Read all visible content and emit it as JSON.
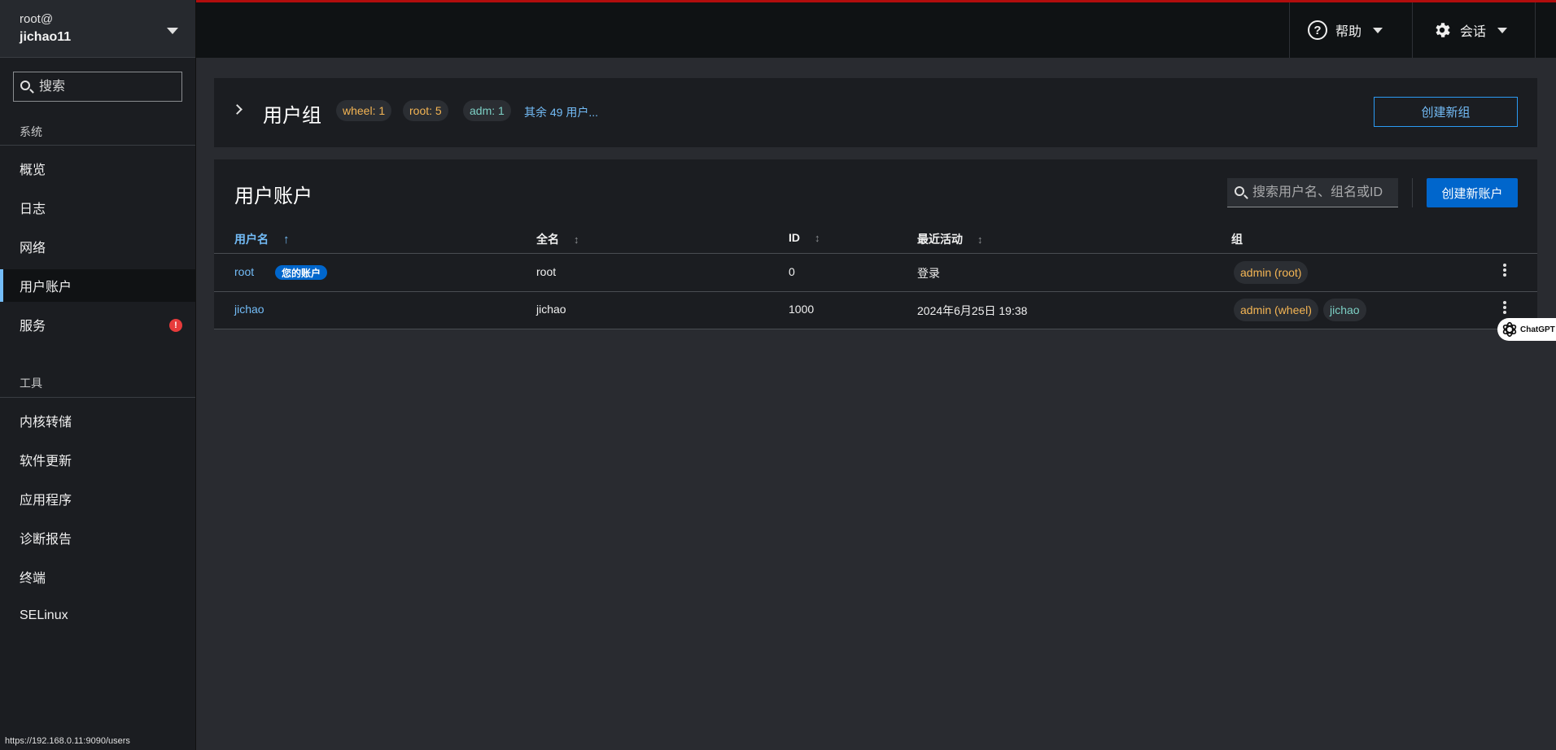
{
  "host": {
    "user": "root@",
    "name": "jichao11"
  },
  "sidebar": {
    "search_placeholder": "搜索",
    "sections": [
      {
        "label": "系统",
        "items": [
          "概览",
          "日志",
          "网络",
          "用户账户",
          "服务"
        ]
      },
      {
        "label": "工具",
        "items": [
          "内核转储",
          "软件更新",
          "应用程序",
          "诊断报告",
          "终端",
          "SELinux"
        ]
      }
    ],
    "active_item": "用户账户",
    "services_alert_glyph": "!"
  },
  "topbar": {
    "help_label": "帮助",
    "session_label": "会话"
  },
  "groups_card": {
    "title": "用户组",
    "chips": [
      {
        "label": "wheel: 1",
        "color": "#f4b554"
      },
      {
        "label": "root: 5",
        "color": "#f4b554"
      },
      {
        "label": "adm: 1",
        "color": "#7dd0c5"
      }
    ],
    "more_link": "其余 49 用户...",
    "create_button": "创建新组"
  },
  "accounts_card": {
    "title": "用户账户",
    "search_placeholder": "搜索用户名、组名或ID",
    "create_button": "创建新账户",
    "columns": [
      "用户名",
      "全名",
      "ID",
      "最近活动",
      "组"
    ],
    "sorted_column": "用户名",
    "sort_direction": "ascending",
    "rows": [
      {
        "username": "root",
        "badge": "您的账户",
        "fullname": "root",
        "id": "0",
        "last_active": "登录",
        "groups": [
          {
            "label": "admin (root)",
            "color": "#f4b554"
          }
        ]
      },
      {
        "username": "jichao",
        "badge": "",
        "fullname": "jichao",
        "id": "1000",
        "last_active": "2024年6月25日 19:38",
        "groups": [
          {
            "label": "admin (wheel)",
            "color": "#f4b554"
          },
          {
            "label": "jichao",
            "color": "#7dd0c5"
          }
        ]
      }
    ]
  },
  "chatgpt_tab": {
    "label": "ChatGPT"
  },
  "status_url": "https://192.168.0.11:9090/users",
  "colors": {
    "accent_link": "#73bcf7",
    "primary_button": "#0066cc",
    "top_stripe": "#b10d0d",
    "alert": "#e73b3b"
  }
}
